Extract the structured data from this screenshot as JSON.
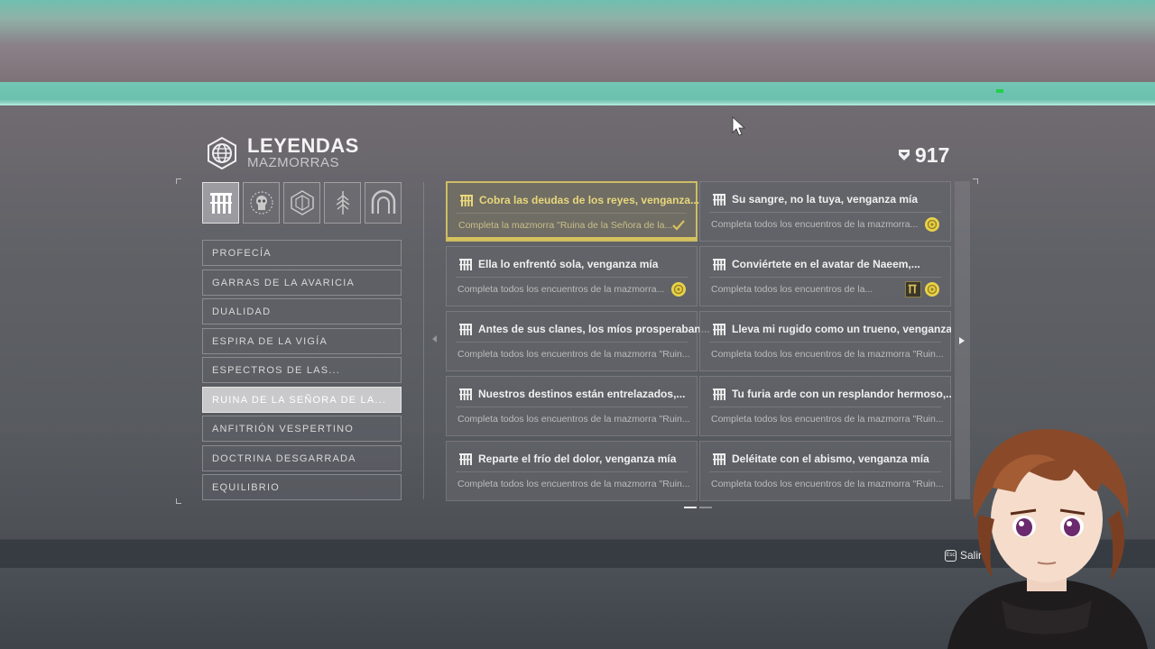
{
  "header": {
    "title": "LEYENDAS",
    "subtitle": "MAZMORRAS",
    "score": "917"
  },
  "tabs": [
    {
      "icon": "dungeon-gate-icon",
      "active": true
    },
    {
      "icon": "skull-emblem-icon",
      "active": false
    },
    {
      "icon": "hexagon-emblem-icon",
      "active": false
    },
    {
      "icon": "feather-emblem-icon",
      "active": false
    },
    {
      "icon": "arch-emblem-icon",
      "active": false
    }
  ],
  "sidebar": {
    "items": [
      {
        "label": "PROFECÍA"
      },
      {
        "label": "GARRAS DE LA AVARICIA"
      },
      {
        "label": "DUALIDAD"
      },
      {
        "label": "ESPIRA DE LA VIGÍA"
      },
      {
        "label": "ESPECTROS DE LAS..."
      },
      {
        "label": "RUINA DE LA SEÑORA DE LA..."
      },
      {
        "label": "ANFITRIÓN VESPERTINO"
      },
      {
        "label": "DOCTRINA DESGARRADA"
      },
      {
        "label": "EQUILIBRIO"
      }
    ],
    "active_index": 5
  },
  "cards": [
    {
      "title": "Cobra las deudas de los reyes, venganza...",
      "desc": "Completa la mazmorra \"Ruina de la Señora de la...",
      "status": "complete"
    },
    {
      "title": "Su sangre, no la tuya, venganza mía",
      "desc": "Completa todos los encuentros de la mazmorra...",
      "status": "coin"
    },
    {
      "title": "Ella lo enfrentó sola, venganza mía",
      "desc": "Completa todos los encuentros de la mazmorra...",
      "status": "coin"
    },
    {
      "title": "Conviértete en el avatar de Naeem,...",
      "desc": "Completa todos los encuentros de la...",
      "status": "seal-coin"
    },
    {
      "title": "Antes de sus clanes, los míos prosperaban...",
      "desc": "Completa todos los encuentros de la mazmorra \"Ruin...",
      "status": "none"
    },
    {
      "title": "Lleva mi rugido como un trueno, venganza...",
      "desc": "Completa todos los encuentros de la mazmorra \"Ruin...",
      "status": "none"
    },
    {
      "title": "Nuestros destinos están entrelazados,...",
      "desc": "Completa todos los encuentros de la mazmorra \"Ruin...",
      "status": "none"
    },
    {
      "title": "Tu furia arde con un resplandor hermoso,...",
      "desc": "Completa todos los encuentros de la mazmorra \"Ruin...",
      "status": "none"
    },
    {
      "title": "Reparte el frío del dolor, venganza mía",
      "desc": "Completa todos los encuentros de la mazmorra \"Ruin...",
      "status": "none"
    },
    {
      "title": "Deléitate con el abismo, venganza mía",
      "desc": "Completa todos los encuentros de la mazmorra \"Ruin...",
      "status": "none"
    }
  ],
  "footer": {
    "exit_key": "Esc",
    "exit_label": "Salir"
  },
  "colors": {
    "accent_gold": "#d7c35c",
    "teal": "#6ac0ad"
  }
}
